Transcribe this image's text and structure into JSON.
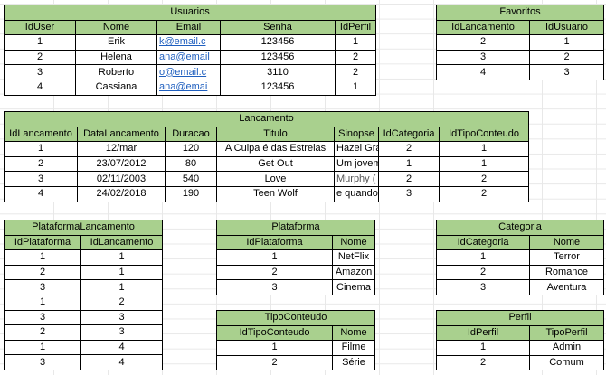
{
  "tables": {
    "usuarios": {
      "title": "Usuarios",
      "headers": [
        "IdUser",
        "Nome",
        "Email",
        "Senha",
        "IdPerfil"
      ],
      "rows": [
        [
          "1",
          "Erik",
          "k@email.c",
          "123456",
          "1"
        ],
        [
          "2",
          "Helena",
          "ana@email",
          "123456",
          "2"
        ],
        [
          "3",
          "Roberto",
          "o@email.c",
          "3110",
          "2"
        ],
        [
          "4",
          "Cassiana",
          "ana@emai",
          "123456",
          "1"
        ]
      ]
    },
    "favoritos": {
      "title": "Favoritos",
      "headers": [
        "IdLancamento",
        "IdUsuario"
      ],
      "rows": [
        [
          "2",
          "1"
        ],
        [
          "3",
          "2"
        ],
        [
          "4",
          "3"
        ]
      ]
    },
    "lancamento": {
      "title": "Lancamento",
      "headers": [
        "IdLancamento",
        "DataLancamento",
        "Duracao",
        "Titulo",
        "Sinopse",
        "IdCategoria",
        "IdTipoConteudo"
      ],
      "rows": [
        [
          "1",
          "12/mar",
          "120",
          "A Culpa é das Estrelas",
          "Hazel Gra",
          "2",
          "1"
        ],
        [
          "2",
          "23/07/2012",
          "80",
          "Get Out",
          "Um jovem",
          "1",
          "1"
        ],
        [
          "3",
          "02/11/2003",
          "540",
          "Love",
          "Murphy (",
          "2",
          "2"
        ],
        [
          "4",
          "24/02/2018",
          "190",
          "Teen Wolf",
          "e quando",
          "3",
          "2"
        ]
      ]
    },
    "plataforma_lancamento": {
      "title": "PlataformaLancamento",
      "headers": [
        "IdPlataforma",
        "IdLancamento"
      ],
      "rows": [
        [
          "1",
          "1"
        ],
        [
          "2",
          "1"
        ],
        [
          "3",
          "1"
        ],
        [
          "1",
          "2"
        ],
        [
          "3",
          "3"
        ],
        [
          "2",
          "3"
        ],
        [
          "1",
          "4"
        ],
        [
          "3",
          "4"
        ]
      ]
    },
    "plataforma": {
      "title": "Plataforma",
      "headers": [
        "IdPlataforma",
        "Nome"
      ],
      "rows": [
        [
          "1",
          "NetFlix"
        ],
        [
          "2",
          "Amazon"
        ],
        [
          "3",
          "Cinema"
        ]
      ]
    },
    "categoria": {
      "title": "Categoria",
      "headers": [
        "IdCategoria",
        "Nome"
      ],
      "rows": [
        [
          "1",
          "Terror"
        ],
        [
          "2",
          "Romance"
        ],
        [
          "3",
          "Aventura"
        ]
      ]
    },
    "tipo_conteudo": {
      "title": "TipoConteudo",
      "headers": [
        "IdTipoConteudo",
        "Nome"
      ],
      "rows": [
        [
          "1",
          "Filme"
        ],
        [
          "2",
          "Série"
        ]
      ]
    },
    "perfil": {
      "title": "Perfil",
      "headers": [
        "IdPerfil",
        "TipoPerfil"
      ],
      "rows": [
        [
          "1",
          "Admin"
        ],
        [
          "2",
          "Comum"
        ]
      ]
    }
  },
  "colors": {
    "header_green": "#a9d08e",
    "link_blue": "#1f5fbf",
    "gridline": "#dadada"
  }
}
